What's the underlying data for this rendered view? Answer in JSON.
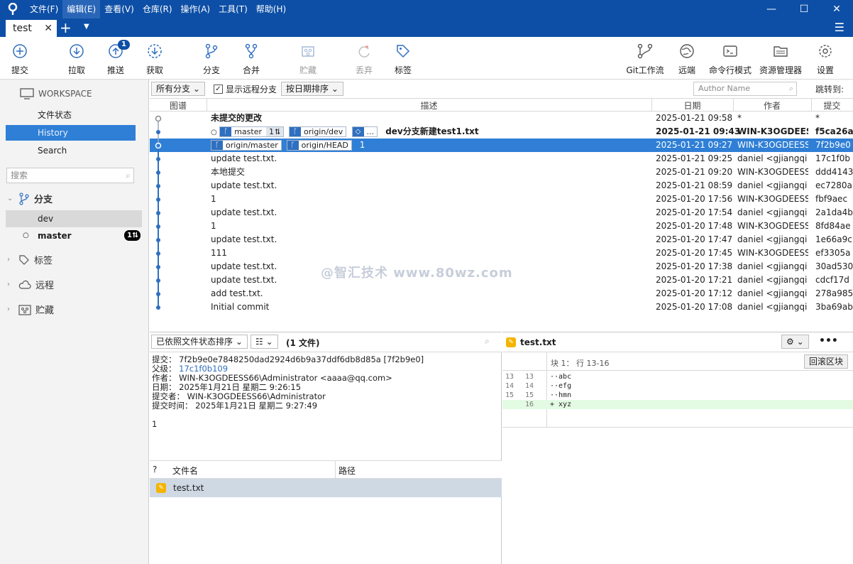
{
  "menu": [
    "文件(F)",
    "编辑(E)",
    "查看(V)",
    "仓库(R)",
    "操作(A)",
    "工具(T)",
    "帮助(H)"
  ],
  "tab": {
    "title": "test"
  },
  "toolbar": {
    "commit": "提交",
    "pull": "拉取",
    "push": "推送",
    "push_badge": "1",
    "fetch": "获取",
    "branch": "分支",
    "merge": "合并",
    "stash": "贮藏",
    "discard": "丢弃",
    "tag": "标签",
    "gitflow": "Git工作流",
    "remote": "远端",
    "terminal": "命令行模式",
    "explorer": "资源管理器",
    "settings": "设置"
  },
  "sidebar": {
    "workspace": "WORKSPACE",
    "file_status": "文件状态",
    "history": "History",
    "search": "Search",
    "search_placeholder": "搜索",
    "branches": "分支",
    "dev": "dev",
    "master": "master",
    "master_badge": "1⮁",
    "tags": "标签",
    "remotes": "远程",
    "stashes": "贮藏"
  },
  "filter": {
    "all_branches": "所有分支 ⌄",
    "show_remote": "显示远程分支",
    "sort_date": "按日期排序 ⌄",
    "author_placeholder": "Author Name",
    "jump": "跳转到:"
  },
  "columns": {
    "graph": "图谱",
    "desc": "描述",
    "date": "日期",
    "author": "作者",
    "commit": "提交"
  },
  "commits": [
    {
      "desc": "未提交的更改",
      "date": "2025-01-21 09:58",
      "author": "*",
      "hash": "*"
    },
    {
      "desc": "dev分支新建test1.txt",
      "date": "2025-01-21 09:43",
      "author": "WIN-K3OGDEESS",
      "hash": "f5ca26a"
    },
    {
      "desc": "1",
      "date": "2025-01-21 09:27",
      "author": "WIN-K3OGDEESS",
      "hash": "7f2b9e0"
    },
    {
      "desc": "update test.txt.",
      "date": "2025-01-21 09:25",
      "author": "daniel <gjiangqi",
      "hash": "17c1f0b"
    },
    {
      "desc": "本地提交",
      "date": "2025-01-21 09:20",
      "author": "WIN-K3OGDEESS",
      "hash": "ddd4143"
    },
    {
      "desc": "update test.txt.",
      "date": "2025-01-21 08:59",
      "author": "daniel <gjiangqi",
      "hash": "ec7280a"
    },
    {
      "desc": "1",
      "date": "2025-01-20 17:56",
      "author": "WIN-K3OGDEESS",
      "hash": "fbf9aec"
    },
    {
      "desc": "update test.txt.",
      "date": "2025-01-20 17:54",
      "author": "daniel <gjiangqi",
      "hash": "2a1da4b"
    },
    {
      "desc": "1",
      "date": "2025-01-20 17:48",
      "author": "WIN-K3OGDEESS",
      "hash": "8fd84ae"
    },
    {
      "desc": "update test.txt.",
      "date": "2025-01-20 17:47",
      "author": "daniel <gjiangqi",
      "hash": "1e66a9c"
    },
    {
      "desc": "111",
      "date": "2025-01-20 17:45",
      "author": "WIN-K3OGDEESS",
      "hash": "ef3305a"
    },
    {
      "desc": "update test.txt.",
      "date": "2025-01-20 17:38",
      "author": "daniel <gjiangqi",
      "hash": "30ad530"
    },
    {
      "desc": "update test.txt.",
      "date": "2025-01-20 17:21",
      "author": "daniel <gjiangqi",
      "hash": "cdcf17d"
    },
    {
      "desc": "add test.txt.",
      "date": "2025-01-20 17:12",
      "author": "daniel <gjiangqi",
      "hash": "278a985"
    },
    {
      "desc": "Initial commit",
      "date": "2025-01-20 17:08",
      "author": "daniel <gjiangqi",
      "hash": "3ba69ab"
    }
  ],
  "refs": {
    "master": "master",
    "master_sync": "1⮁",
    "origin_dev": "origin/dev",
    "tag_more": "...",
    "origin_master": "origin/master",
    "origin_head": "origin/HEAD"
  },
  "watermark": "@智汇技术 www.80wz.com",
  "details": {
    "sort": "已依照文件状态排序 ⌄",
    "view": "☷ ⌄",
    "count": "(1 文件)",
    "commit_line": "提交： 7f2b9e0e7848250dad2924d6b9a37ddf6db8d85a [7f2b9e0]",
    "parent_label": "父级：",
    "parent": "17c1f0b109",
    "author_line": "作者： WIN-K3OGDEESS66\\Administrator <aaaa@qq.com>",
    "date_line": "日期： 2025年1月21日 星期二 9:26:15",
    "committer_line": "提交者： WIN-K3OGDEESS66\\Administrator",
    "commit_time_line": "提交时间： 2025年1月21日 星期二 9:27:49",
    "message": "1",
    "file_col_q": "?",
    "file_col_name": "文件名",
    "file_col_path": "路径",
    "file": "test.txt"
  },
  "diff": {
    "file": "test.txt",
    "hunk": "块 1： 行 13-16",
    "revert": "回滚区块",
    "lines": [
      {
        "n1": "13",
        "n2": "13",
        "t": "··abc",
        "add": false
      },
      {
        "n1": "14",
        "n2": "14",
        "t": "··efg",
        "add": false
      },
      {
        "n1": "15",
        "n2": "15",
        "t": "··hmn",
        "add": false
      },
      {
        "n1": "",
        "n2": "16",
        "t": "+ xyz",
        "add": true
      }
    ]
  }
}
